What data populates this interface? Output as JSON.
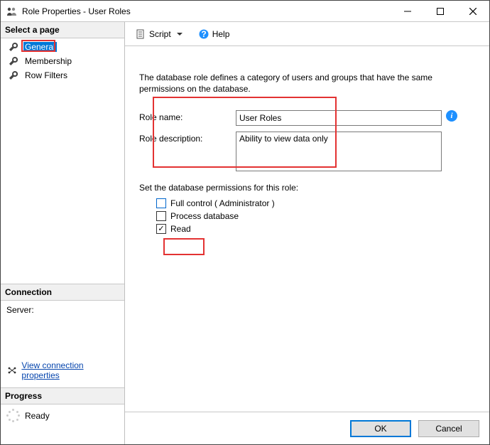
{
  "titlebar": {
    "title": "Role Properties - User Roles"
  },
  "sidebar": {
    "header_pages": "Select a page",
    "nav": {
      "general": "General",
      "membership": "Membership",
      "row_filters": "Row Filters"
    },
    "header_connection": "Connection",
    "server_label": "Server:",
    "view_conn_link": "View connection properties",
    "header_progress": "Progress",
    "progress_status": "Ready"
  },
  "toolbar": {
    "script_label": "Script",
    "help_label": "Help"
  },
  "content": {
    "intro": "The database role defines a category of users and groups that have the same permissions on the database.",
    "role_name_label": "Role name:",
    "role_name_value": "User Roles",
    "role_desc_label": "Role description:",
    "role_desc_value": "Ability to view data only",
    "perm_header": "Set the database permissions for this role:",
    "perm_full": "Full control ( Administrator )",
    "perm_process": "Process database",
    "perm_read": "Read"
  },
  "footer": {
    "ok": "OK",
    "cancel": "Cancel"
  }
}
